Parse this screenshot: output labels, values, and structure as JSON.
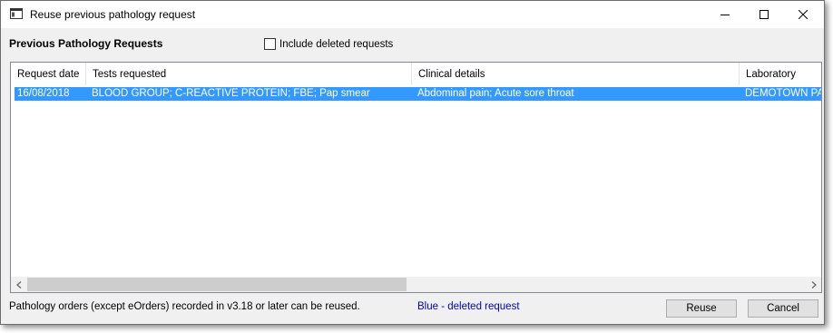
{
  "window": {
    "title": "Reuse previous pathology request",
    "icon": "window-app-icon",
    "controls": [
      "minimize-icon",
      "maximize-icon",
      "close-icon"
    ]
  },
  "header": {
    "title": "Previous Pathology Requests",
    "include_deleted_label": "Include deleted requests",
    "include_deleted_checked": false
  },
  "table": {
    "columns": [
      "Request date",
      "Tests requested",
      "Clinical details",
      "Laboratory"
    ],
    "rows": [
      {
        "date": "16/08/2018",
        "tests": "BLOOD GROUP;  C-REACTIVE PROTEIN;  FBE;  Pap smear",
        "clinical": "Abdominal pain;  Acute sore throat",
        "lab": "DEMOTOWN PA",
        "selected": true
      }
    ]
  },
  "footer": {
    "note": "Pathology orders (except eOrders) recorded in v3.18 or later can be reused.",
    "legend": "Blue - deleted request",
    "legend_color": "#0000cc",
    "reuse_label": "Reuse",
    "cancel_label": "Cancel"
  },
  "colors": {
    "selection": "#3399ff",
    "dialog_bg": "#f0f0f0"
  }
}
